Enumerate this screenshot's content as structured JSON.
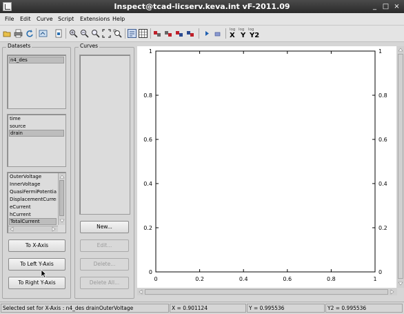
{
  "window": {
    "title": "Inspect@tcad-licserv.keva.int vF-2011.09",
    "controls": {
      "minimize": "_",
      "maximize": "□",
      "close": "×"
    }
  },
  "menu": [
    "File",
    "Edit",
    "Curve",
    "Script",
    "Extensions",
    "Help"
  ],
  "toolbar": {
    "icons": [
      "open-folder-icon",
      "print-icon",
      "reload-icon",
      "undo-icon",
      "page-icon",
      "zoom-in-icon",
      "zoom-out-icon",
      "zoom-fit-icon",
      "zoom-full-icon",
      "zoom-region-icon",
      "legend-icon",
      "grid-icon",
      "curve-red-1-icon",
      "curve-red-2-icon",
      "curve-red-3-icon",
      "curve-red-4-icon",
      "play-icon",
      "stop-icon"
    ],
    "log_label": "log",
    "log_x": "X",
    "log_y": "Y",
    "log_y2": "Y2"
  },
  "datasets": {
    "label": "Datasets",
    "files": [
      "n4_des"
    ],
    "groups": [
      "time",
      "source",
      "drain"
    ],
    "selected_group": "drain",
    "quantities": [
      "OuterVoltage",
      "InnerVoltage",
      "QuasiFermiPotential",
      "DisplacementCurrent",
      "eCurrent",
      "hCurrent",
      "TotalCurrent"
    ],
    "selected_quantity": "TotalCurrent",
    "buttons": {
      "to_x": "To X-Axis",
      "to_left_y": "To Left Y-Axis",
      "to_right_y": "To Right Y-Axis"
    }
  },
  "curves": {
    "label": "Curves",
    "buttons": {
      "new": "New...",
      "edit": "Edit...",
      "delete": "Delete...",
      "delete_all": "Delete All..."
    }
  },
  "chart_data": {
    "type": "line",
    "series": [],
    "title": "",
    "xlabel": "",
    "ylabel": "",
    "xlim": [
      0,
      1
    ],
    "ylim": [
      0,
      1
    ],
    "xticks": [
      "0",
      "0.2",
      "0.4",
      "0.6",
      "0.8",
      "1"
    ],
    "yticks": [
      "0",
      "0.2",
      "0.4",
      "0.6",
      "0.8",
      "1"
    ],
    "y2ticks": [
      "0",
      "0.2",
      "0.4",
      "0.6",
      "0.8",
      "1"
    ],
    "grid": false
  },
  "status": {
    "message": "Selected set for X-Axis : n4_des drainOuterVoltage",
    "x": "X = 0.901124",
    "y": "Y = 0.995536",
    "y2": "Y2 = 0.995536"
  }
}
